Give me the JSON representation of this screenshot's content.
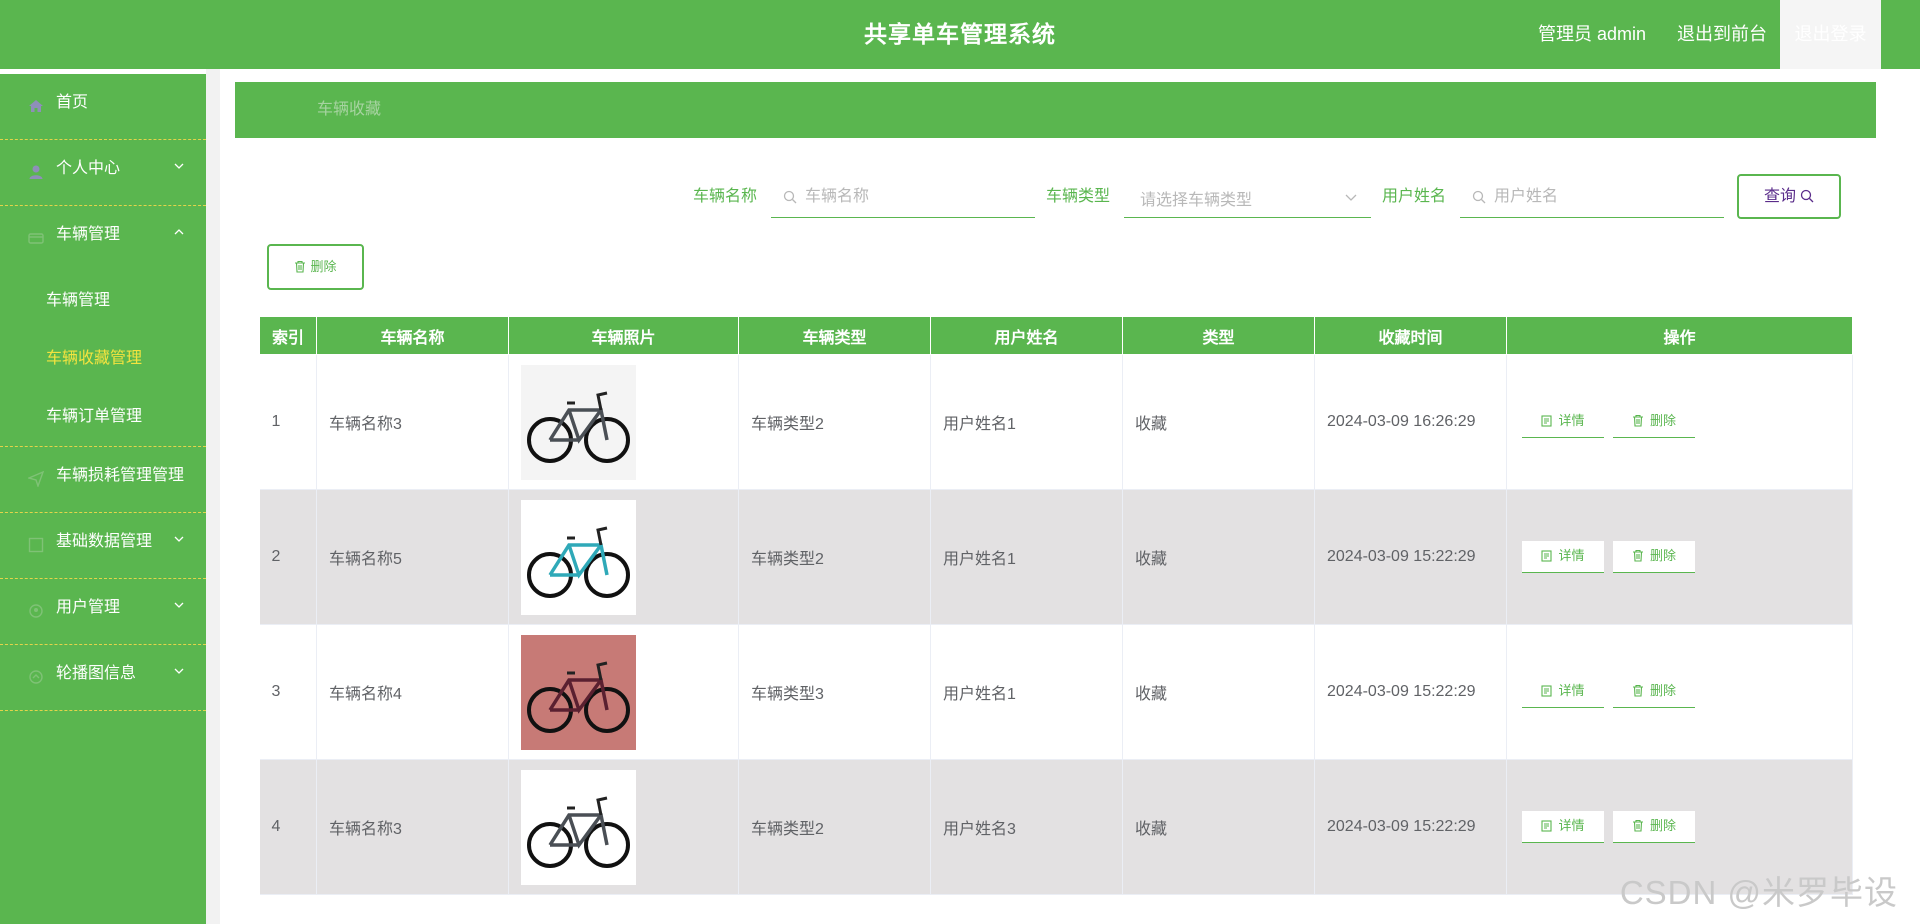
{
  "header": {
    "title": "共享单车管理系统",
    "admin": "管理员 admin",
    "front": "退出到前台",
    "logout": "退出登录"
  },
  "sidebar": {
    "items": [
      {
        "label": "首页",
        "icon": "home-icon"
      },
      {
        "label": "个人中心",
        "icon": "user-icon"
      },
      {
        "label": "车辆管理",
        "icon": "bike-icon"
      },
      {
        "label": "车辆损耗管理管理",
        "icon": "send-icon"
      },
      {
        "label": "基础数据管理",
        "icon": "grid-icon"
      },
      {
        "label": "用户管理",
        "icon": "user-icon"
      },
      {
        "label": "轮播图信息",
        "icon": "image-icon"
      }
    ],
    "submenu": [
      "车辆管理",
      "车辆收藏管理",
      "车辆订单管理"
    ]
  },
  "breadcrumb": "车辆收藏",
  "search": {
    "name_label": "车辆名称",
    "name_placeholder": "车辆名称",
    "type_label": "车辆类型",
    "type_placeholder": "请选择车辆类型",
    "user_label": "用户姓名",
    "user_placeholder": "用户姓名",
    "query_button": "查询"
  },
  "actions": {
    "delete": "删除"
  },
  "table": {
    "headers": [
      "索引",
      "车辆名称",
      "车辆照片",
      "车辆类型",
      "用户姓名",
      "类型",
      "收藏时间",
      "操作"
    ],
    "detail_label": "详情",
    "delete_label": "删除",
    "rows": [
      {
        "index": "1",
        "name": "车辆名称3",
        "type": "车辆类型2",
        "user": "用户姓名1",
        "kind": "收藏",
        "time": "2024-03-09 16:26:29",
        "bike_color": "#4a4f55"
      },
      {
        "index": "2",
        "name": "车辆名称5",
        "type": "车辆类型2",
        "user": "用户姓名1",
        "kind": "收藏",
        "time": "2024-03-09 15:22:29",
        "bike_color": "#2fa9b8"
      },
      {
        "index": "3",
        "name": "车辆名称4",
        "type": "车辆类型3",
        "user": "用户姓名1",
        "kind": "收藏",
        "time": "2024-03-09 15:22:29",
        "bike_color": "#5a2030"
      },
      {
        "index": "4",
        "name": "车辆名称3",
        "type": "车辆类型2",
        "user": "用户姓名3",
        "kind": "收藏",
        "time": "2024-03-09 15:22:29",
        "bike_color": "#4a4f55"
      }
    ]
  },
  "watermark": "CSDN @米罗毕设",
  "colors": {
    "primary": "#5ab64f",
    "active_menu": "#f3e33f",
    "row_alt": "#e3e1e2"
  }
}
